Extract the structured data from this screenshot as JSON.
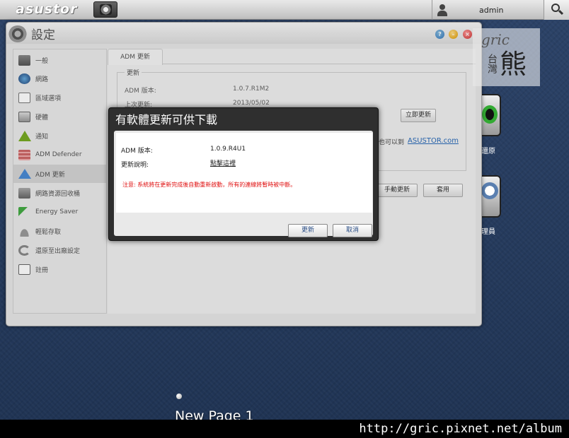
{
  "topbar": {
    "brand": "asustor",
    "username": "admin"
  },
  "window": {
    "title": "設定"
  },
  "sidebar": {
    "items": [
      {
        "label": "一般",
        "icon": "general-icon"
      },
      {
        "label": "網路",
        "icon": "network-icon"
      },
      {
        "label": "區域選項",
        "icon": "regional-icon"
      },
      {
        "label": "硬體",
        "icon": "hardware-icon"
      },
      {
        "label": "通知",
        "icon": "notification-icon"
      },
      {
        "label": "ADM Defender",
        "icon": "defender-icon"
      },
      {
        "label": "ADM 更新",
        "icon": "update-icon"
      },
      {
        "label": "網路資源回收桶",
        "icon": "recycle-bin-icon"
      },
      {
        "label": "Energy Saver",
        "icon": "energy-saver-icon"
      },
      {
        "label": "輕鬆存取",
        "icon": "ez-connect-icon"
      },
      {
        "label": "還原至出廠設定",
        "icon": "reset-icon"
      },
      {
        "label": "註冊",
        "icon": "registration-icon"
      }
    ]
  },
  "content": {
    "tab": "ADM 更新",
    "section": "更新",
    "adm_version_label": "ADM 版本:",
    "adm_version_value": "1.0.7.R1M2",
    "last_update_label": "上次更新:",
    "last_update_value": "2013/05/02",
    "update_now": "立即更新",
    "also_text": "也可以到",
    "also_link": "ASUSTOR.com",
    "manual_update": "手動更新",
    "apply": "套用"
  },
  "desktop": {
    "icon1_label": "還原",
    "icon2_label": "理員",
    "page_label": "New Page 1"
  },
  "dialog": {
    "title": "有軟體更新可供下載",
    "version_label": "ADM 版本:",
    "version_value": "1.0.9.R4U1",
    "notes_label": "更新說明:",
    "notes_link": "點擊這裡",
    "warning": "注意: 系統將在更新完成後自動重新啟動，所有的連線將暫時被中斷。",
    "update_btn": "更新",
    "cancel_btn": "取消"
  },
  "watermark": {
    "line1": "gric",
    "line2": "台灣",
    "line3": "熊"
  },
  "footer_url": "http://gric.pixnet.net/album"
}
